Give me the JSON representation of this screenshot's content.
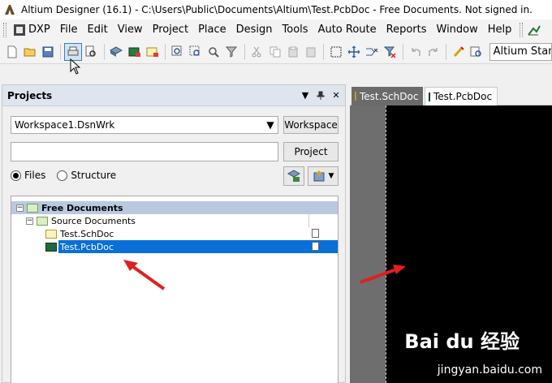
{
  "window": {
    "title": "Altium Designer (16.1) - C:\\Users\\Public\\Documents\\Altium\\Test.PcbDoc - Free Documents. Not signed in."
  },
  "menu": {
    "items": [
      "DXP",
      "File",
      "Edit",
      "View",
      "Project",
      "Place",
      "Design",
      "Tools",
      "Auto Route",
      "Reports",
      "Window",
      "Help"
    ]
  },
  "toolbar": {
    "standard_input": "Altium Stand"
  },
  "projects_panel": {
    "title": "Projects",
    "workspace_combo": "Workspace1.DsnWrk",
    "workspace_button": "Workspace",
    "project_input": "",
    "project_button": "Project",
    "view_files": "Files",
    "view_structure": "Structure",
    "tree": {
      "root": "Free Documents",
      "group": "Source Documents",
      "items": [
        "Test.SchDoc",
        "Test.PcbDoc"
      ]
    }
  },
  "document_tabs": [
    "Test.SchDoc",
    "Test.PcbDoc"
  ],
  "watermark": {
    "brand": "Bai du 经验",
    "url": "jingyan.baidu.com"
  },
  "colors": {
    "selection": "#0a6fd6",
    "root_highlight": "#b9c9e0",
    "arrow": "#e02020",
    "panel_header": "#dfe5ee"
  }
}
